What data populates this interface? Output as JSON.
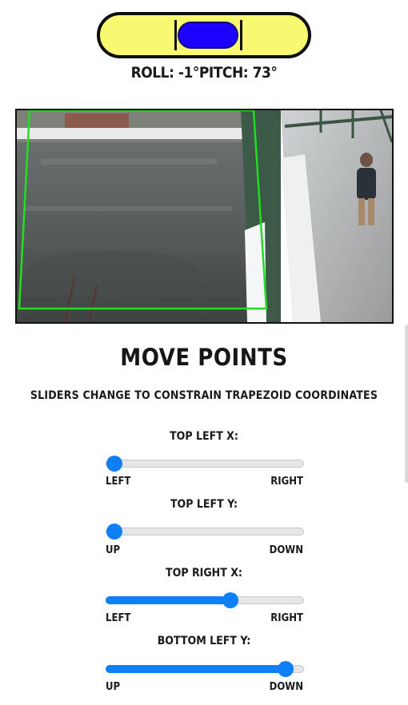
{
  "level": {
    "roll_label": "ROLL: -1°",
    "pitch_label": "PITCH: 73°"
  },
  "camera": {
    "alt": "Live camera view of river from bridge"
  },
  "heading": "MOVE POINTS",
  "subheading": "SLIDERS CHANGE TO CONSTRAIN TRAPEZOID COORDINATES",
  "sliders": [
    {
      "label": "TOP LEFT X:",
      "min_label": "LEFT",
      "max_label": "RIGHT",
      "value": 0.04
    },
    {
      "label": "TOP LEFT Y:",
      "min_label": "UP",
      "max_label": "DOWN",
      "value": 0.04
    },
    {
      "label": "TOP RIGHT X:",
      "min_label": "LEFT",
      "max_label": "RIGHT",
      "value": 0.63
    },
    {
      "label": "BOTTOM LEFT Y:",
      "min_label": "UP",
      "max_label": "DOWN",
      "value": 0.91
    }
  ],
  "colors": {
    "accent": "#0f7ff6",
    "level_fill": "#f9f871",
    "bubble": "#1e00ff",
    "overlay": "#22dd22"
  }
}
